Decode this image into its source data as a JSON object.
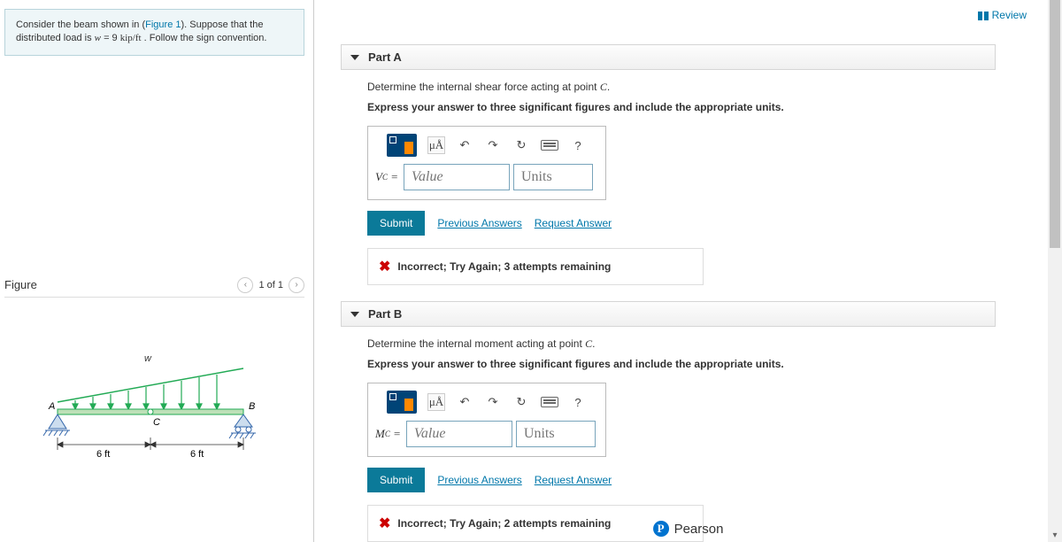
{
  "review_label": "Review",
  "problem": {
    "prefix": "Consider the beam shown in (",
    "figlink": "Figure 1",
    "mid": "). Suppose that the distributed load is ",
    "var": "w",
    "eq": " = 9 ",
    "unit": "kip/ft",
    "suffix": " . Follow the sign convention."
  },
  "figure": {
    "title": "Figure",
    "counter": "1 of 1",
    "labels": {
      "w": "w",
      "A": "A",
      "B": "B",
      "C": "C",
      "d1": "6 ft",
      "d2": "6 ft"
    }
  },
  "parts": [
    {
      "id": "A",
      "header": "Part A",
      "prompt_pre": "Determine the internal shear force acting at point ",
      "prompt_pt": "C",
      "prompt_post": ".",
      "instruction": "Express your answer to three significant figures and include the appropriate units.",
      "var_html": "V",
      "var_sub": "C",
      "value_ph": "Value",
      "units_ph": "Units",
      "submit": "Submit",
      "prev": "Previous Answers",
      "req": "Request Answer",
      "feedback": "Incorrect; Try Again; 3 attempts remaining",
      "tools": {
        "mu": "μÅ",
        "help": "?"
      }
    },
    {
      "id": "B",
      "header": "Part B",
      "prompt_pre": "Determine the internal moment acting at point ",
      "prompt_pt": "C",
      "prompt_post": ".",
      "instruction": "Express your answer to three significant figures and include the appropriate units.",
      "var_html": "M",
      "var_sub": "C",
      "value_ph": "Value",
      "units_ph": "Units",
      "submit": "Submit",
      "prev": "Previous Answers",
      "req": "Request Answer",
      "feedback": "Incorrect; Try Again; 2 attempts remaining",
      "tools": {
        "mu": "μÅ",
        "help": "?"
      }
    }
  ],
  "brand": "Pearson"
}
